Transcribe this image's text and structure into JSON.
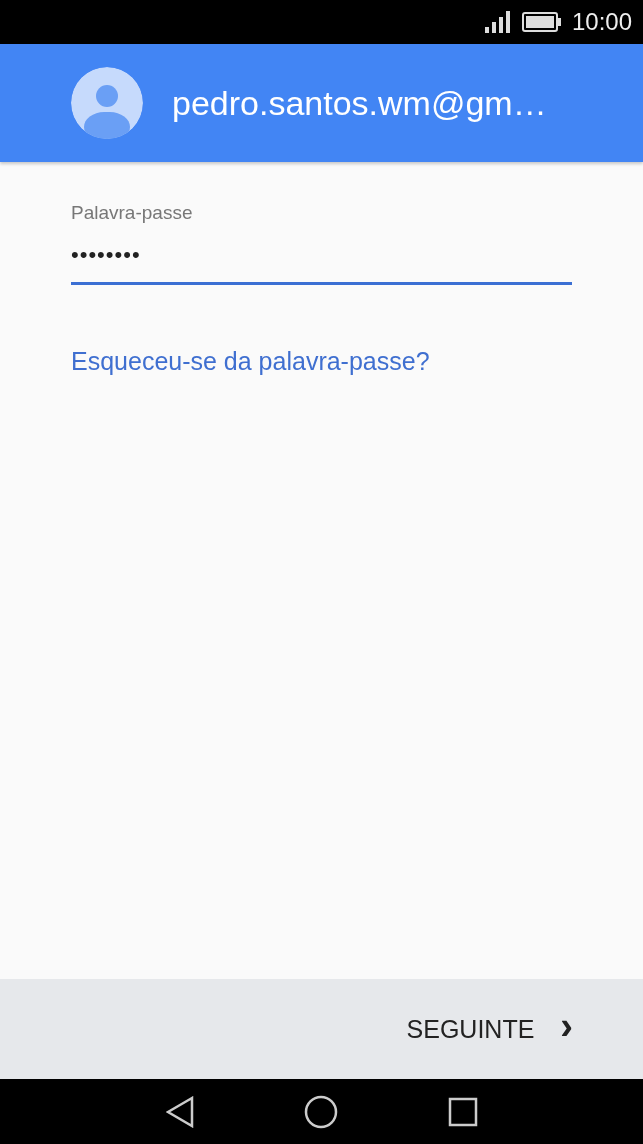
{
  "status_bar": {
    "time": "10:00"
  },
  "header": {
    "account": "pedro.santos.wm@gm…"
  },
  "password_field": {
    "label": "Palavra-passe",
    "value": "••••••••",
    "focused": true
  },
  "forgot_link": "Esqueceu-se da palavra-passe?",
  "footer": {
    "next_button": "SEGUINTE",
    "next_icon": "›"
  }
}
